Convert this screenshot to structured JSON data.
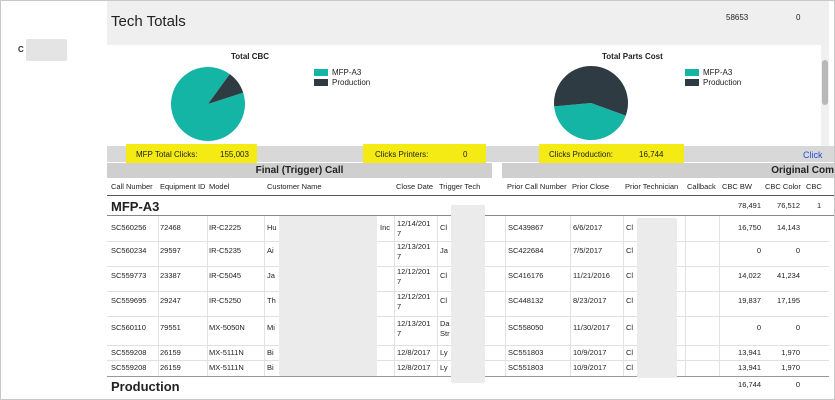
{
  "left_panel": {
    "label": "C"
  },
  "tech_totals": {
    "title": "Tech Totals",
    "value1": "58653",
    "value2": "0"
  },
  "charts": [
    {
      "title": "Total CBC",
      "legend": [
        {
          "name": "MFP-A3",
          "color": "#14b5a4"
        },
        {
          "name": "Production",
          "color": "#2f3b42"
        }
      ]
    },
    {
      "title": "Total Parts Cost",
      "legend": [
        {
          "name": "MFP-A3",
          "color": "#14b5a4"
        },
        {
          "name": "Production",
          "color": "#2f3b42"
        }
      ]
    }
  ],
  "chart_data": [
    {
      "type": "pie",
      "title": "Total CBC",
      "series": [
        {
          "name": "MFP-A3",
          "value": 0.9
        },
        {
          "name": "Production",
          "value": 0.1
        }
      ],
      "colors": [
        "#14b5a4",
        "#2f3b42"
      ]
    },
    {
      "type": "pie",
      "title": "Total Parts Cost",
      "series": [
        {
          "name": "MFP-A3",
          "value": 0.43
        },
        {
          "name": "Production",
          "value": 0.57
        }
      ],
      "colors": [
        "#14b5a4",
        "#2f3b42"
      ]
    }
  ],
  "summary": {
    "mfp_label": "MFP Total Clicks:",
    "mfp_value": "155,003",
    "printers_label": "Clicks Printers:",
    "printers_value": "0",
    "production_label": "Clicks Production:",
    "production_value": "16,744",
    "link_text": "Click"
  },
  "sections": {
    "left": "Final (Trigger) Call",
    "right": "Original Com"
  },
  "columns": [
    "Call Number",
    "Equipment ID",
    "Model",
    "Customer Name",
    "Close Date",
    "Trigger Tech",
    "Prior Call Number",
    "Prior Close",
    "Prior Technician",
    "Callback",
    "CBC BW",
    "CBC Color",
    "CBC"
  ],
  "groups": {
    "mfp": {
      "title": "MFP-A3",
      "bw": "78,491",
      "color": "76,512",
      "extra": "1"
    },
    "production": {
      "title": "Production",
      "bw": "16,744",
      "color": "0"
    }
  },
  "rows": [
    {
      "call": "SC560256",
      "equip": "72468",
      "model": "IR-C2225",
      "customer": "Hu",
      "customer_suffix": "Inc",
      "close_date": [
        "12/14/201",
        "7"
      ],
      "tech": "Cl",
      "prior_call": "SC439867",
      "prior_close": "6/6/2017",
      "prior_tech": "Cl",
      "bw": "16,750",
      "color": "14,143"
    },
    {
      "call": "SC560234",
      "equip": "29597",
      "model": "IR-C5235",
      "customer": "Ai",
      "customer_suffix": "",
      "close_date": [
        "12/13/201",
        "7"
      ],
      "tech": "Ja",
      "prior_call": "SC422684",
      "prior_close": "7/5/2017",
      "prior_tech": "Cl",
      "bw": "0",
      "color": "0"
    },
    {
      "call": "SC559773",
      "equip": "23387",
      "model": "IR-C5045",
      "customer": "Ja",
      "customer_suffix": "",
      "close_date": [
        "12/12/201",
        "7"
      ],
      "tech": "Cl",
      "prior_call": "SC416176",
      "prior_close": "11/21/2016",
      "prior_tech": "Cl",
      "bw": "14,022",
      "color": "41,234"
    },
    {
      "call": "SC559695",
      "equip": "29247",
      "model": "IR-C5250",
      "customer": "Th",
      "customer_suffix": "",
      "close_date": [
        "12/12/201",
        "7"
      ],
      "tech": "Cl",
      "prior_call": "SC448132",
      "prior_close": "8/23/2017",
      "prior_tech": "Cl",
      "bw": "19,837",
      "color": "17,195"
    },
    {
      "call": "SC560110",
      "equip": "79551",
      "model": "MX-5050N",
      "customer": "Mi",
      "customer_suffix": "",
      "close_date": [
        "12/13/201",
        "7"
      ],
      "tech": "Da",
      "tech2": "Str",
      "prior_call": "SC558050",
      "prior_close": "11/30/2017",
      "prior_tech": "Cl",
      "bw": "0",
      "color": "0"
    },
    {
      "call": "SC559208",
      "equip": "26159",
      "model": "MX-5111N",
      "customer": "Bi",
      "customer_suffix": "",
      "close_date": [
        "12/8/2017"
      ],
      "tech": "Ly",
      "prior_call": "SC551803",
      "prior_close": "10/9/2017",
      "prior_tech": "Cl",
      "bw": "13,941",
      "color": "1,970"
    },
    {
      "call": "SC559208",
      "equip": "26159",
      "model": "MX-5111N",
      "customer": "Bi",
      "customer_suffix": "",
      "close_date": [
        "12/8/2017"
      ],
      "tech": "Ly",
      "prior_call": "SC551803",
      "prior_close": "10/9/2017",
      "prior_tech": "Cl",
      "bw": "13,941",
      "color": "1,970"
    }
  ]
}
